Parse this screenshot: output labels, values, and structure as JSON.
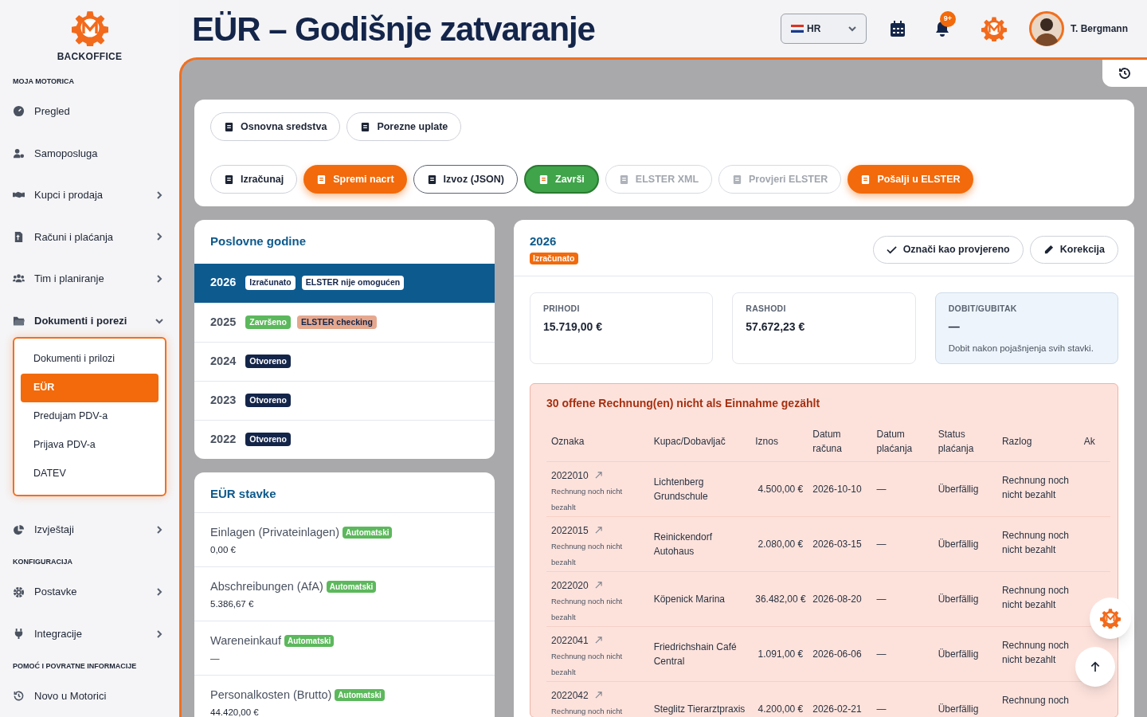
{
  "brand": {
    "name": "BACKOFFICE"
  },
  "sidebar": {
    "sections": [
      {
        "title": "MOJA MOTORICA",
        "items": [
          {
            "label": "Pregled",
            "expandable": false
          },
          {
            "label": "Samoposluga",
            "expandable": false
          },
          {
            "label": "Kupci i prodaja",
            "expandable": true,
            "expanded": false
          },
          {
            "label": "Računi i plaćanja",
            "expandable": true,
            "expanded": false
          },
          {
            "label": "Tim i planiranje",
            "expandable": true,
            "expanded": false
          },
          {
            "label": "Dokumenti i porezi",
            "expandable": true,
            "expanded": true,
            "children": [
              {
                "label": "Dokumenti i prilozi",
                "selected": false
              },
              {
                "label": "EÜR",
                "selected": true
              },
              {
                "label": "Predujam PDV-a",
                "selected": false
              },
              {
                "label": "Prijava PDV-a",
                "selected": false
              },
              {
                "label": "DATEV",
                "selected": false
              }
            ]
          },
          {
            "label": "Izvještaji",
            "expandable": true,
            "expanded": false
          }
        ]
      },
      {
        "title": "KONFIGURACIJA",
        "items": [
          {
            "label": "Postavke",
            "expandable": true,
            "expanded": false
          },
          {
            "label": "Integracije",
            "expandable": true,
            "expanded": false
          }
        ]
      },
      {
        "title": "POMOĆ I POVRATNE INFORMACIJE",
        "items": [
          {
            "label": "Novo u Motorici",
            "expandable": false
          }
        ]
      }
    ]
  },
  "header": {
    "title": "EÜR – Godišnje zatvaranje",
    "language": "HR",
    "notifications": "9+",
    "user": "T. Bergmann"
  },
  "toolbar": {
    "rows": [
      [
        {
          "label": "Osnovna sredstva",
          "kind": "outline",
          "disabled": false
        },
        {
          "label": "Porezne uplate",
          "kind": "outline",
          "disabled": false
        }
      ],
      [
        {
          "label": "Izračunaj",
          "kind": "outline",
          "disabled": false
        },
        {
          "label": "Spremi nacrt",
          "kind": "primary",
          "disabled": false
        },
        {
          "label": "Izvoz (JSON)",
          "kind": "dark-outline",
          "disabled": false
        },
        {
          "label": "Završi",
          "kind": "success",
          "disabled": false
        },
        {
          "label": "ELSTER XML",
          "kind": "outline",
          "disabled": true
        },
        {
          "label": "Provjeri ELSTER",
          "kind": "outline",
          "disabled": true
        },
        {
          "label": "Pošalji u ELSTER",
          "kind": "primary",
          "disabled": false
        }
      ]
    ]
  },
  "years": {
    "title": "Poslovne godine",
    "rows": [
      {
        "year": "2026",
        "selected": true,
        "badges": [
          {
            "text": "Izračunato",
            "color": "#ffffff"
          },
          {
            "text": "ELSTER nije omogućen",
            "color": "#ffffff"
          }
        ]
      },
      {
        "year": "2025",
        "selected": false,
        "badges": [
          {
            "text": "Završeno",
            "color": "#5cb85c"
          },
          {
            "text": "ELSTER checking",
            "color": "#e5a88e"
          }
        ]
      },
      {
        "year": "2024",
        "selected": false,
        "badges": [
          {
            "text": "Otvoreno",
            "color": "#14254a"
          }
        ]
      },
      {
        "year": "2023",
        "selected": false,
        "badges": [
          {
            "text": "Otvoreno",
            "color": "#14254a"
          }
        ]
      },
      {
        "year": "2022",
        "selected": false,
        "badges": [
          {
            "text": "Otvoreno",
            "color": "#14254a"
          }
        ]
      }
    ]
  },
  "items": {
    "title": "EÜR stavke",
    "rows": [
      {
        "label": "Einlagen (Privateinlagen)",
        "badge": "Automatski",
        "value": "0,00 €"
      },
      {
        "label": "Abschreibungen (AfA)",
        "badge": "Automatski",
        "value": "5.386,67 €"
      },
      {
        "label": "Wareneinkauf",
        "badge": "Automatski",
        "value": "—"
      },
      {
        "label": "Personalkosten (Brutto)",
        "badge": "Automatski",
        "value": "44.420,00 €"
      }
    ]
  },
  "detail": {
    "year": "2026",
    "status": "Izračunato",
    "actions": [
      "Označi kao provjereno",
      "Korekcija"
    ],
    "stats": [
      {
        "label": "PRIHODI",
        "value": "15.719,00 €",
        "highlighted": false
      },
      {
        "label": "RASHODI",
        "value": "57.672,23 €",
        "highlighted": false
      },
      {
        "label": "DOBIT/GUBITAK",
        "value": "—",
        "note": "Dobit nakon pojašnjenja svih stavki.",
        "highlighted": true
      }
    ],
    "warning": {
      "title": "30 offene Rechnung(en) nicht als Einnahme gezählt",
      "columns": [
        "Oznaka",
        "Kupac/Dobavljač",
        "Iznos",
        "Datum računa",
        "Datum plaćanja",
        "Status plaćanja",
        "Razlog",
        "Ak"
      ],
      "rows": [
        {
          "id": "2022010",
          "note": "Rechnung noch nicht bezahlt",
          "party": "Lichtenberg Grundschule",
          "amount": "4.500,00 €",
          "invoice_date": "2026-10-10",
          "payment_date": "—",
          "status": "Überfällig",
          "reason": "Rechnung noch nicht bezahlt"
        },
        {
          "id": "2022015",
          "note": "Rechnung noch nicht bezahlt",
          "party": "Reinickendorf Autohaus",
          "amount": "2.080,00 €",
          "invoice_date": "2026-03-15",
          "payment_date": "—",
          "status": "Überfällig",
          "reason": "Rechnung noch nicht bezahlt"
        },
        {
          "id": "2022020",
          "note": "Rechnung noch nicht bezahlt",
          "party": "Köpenick Marina",
          "amount": "36.482,00 €",
          "invoice_date": "2026-08-20",
          "payment_date": "—",
          "status": "Überfällig",
          "reason": "Rechnung noch nicht bezahlt"
        },
        {
          "id": "2022041",
          "note": "Rechnung noch nicht bezahlt",
          "party": "Friedrichshain Café Central",
          "amount": "1.091,00 €",
          "invoice_date": "2026-06-06",
          "payment_date": "—",
          "status": "Überfällig",
          "reason": "Rechnung noch nicht bezahlt"
        },
        {
          "id": "2022042",
          "note": "Rechnung noch nicht",
          "party": "Steglitz Tierarztpraxis",
          "amount": "4.200,00 €",
          "invoice_date": "2026-02-21",
          "payment_date": "—",
          "status": "Überfällig",
          "reason": "Rechnung noch"
        }
      ]
    }
  }
}
